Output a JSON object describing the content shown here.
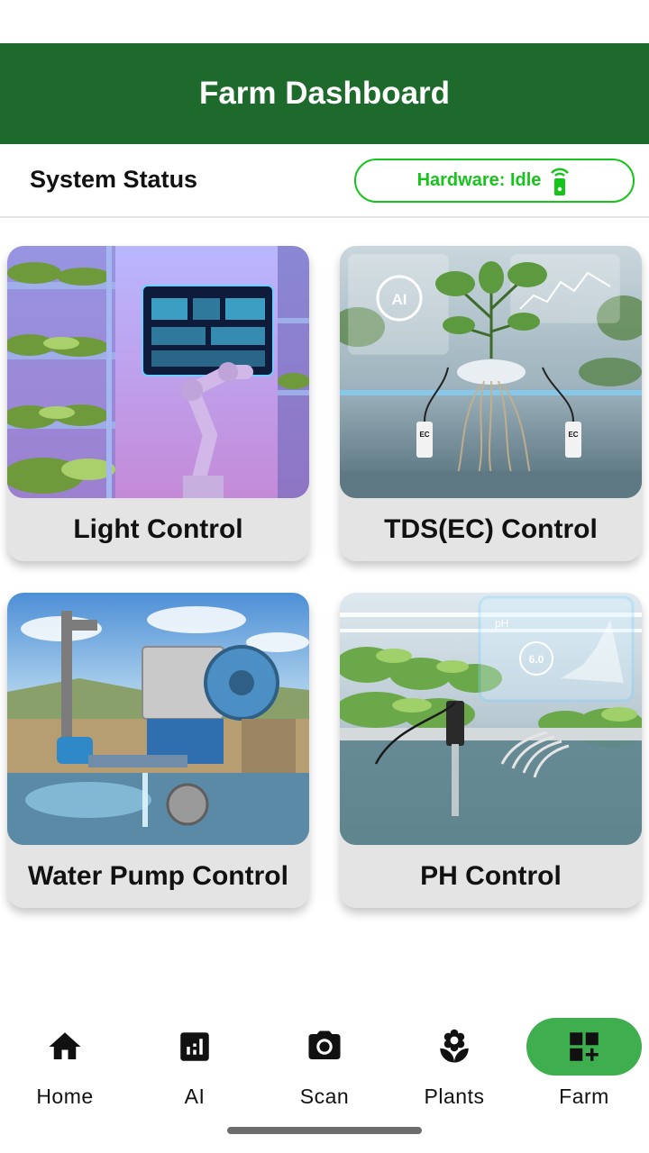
{
  "app_bar": {
    "title": "Farm Dashboard"
  },
  "status": {
    "title": "System Status",
    "hardware_label": "Hardware: Idle",
    "hardware_color": "#16c41c",
    "hardware_icon": "signal-device-icon"
  },
  "cards": [
    {
      "label": "Light Control",
      "image": "vertical-farm-robot-image"
    },
    {
      "label": "TDS(EC) Control",
      "image": "hydroponic-ec-sensor-image"
    },
    {
      "label": "Water Pump Control",
      "image": "water-pump-image"
    },
    {
      "label": "PH Control",
      "image": "ph-sensor-image"
    }
  ],
  "image_text": {
    "ai": "AI",
    "ec": "EC",
    "ph": "pH",
    "ph_value": "6.0"
  },
  "nav": {
    "items": [
      {
        "label": "Home",
        "icon": "home-icon"
      },
      {
        "label": "AI",
        "icon": "analytics-icon"
      },
      {
        "label": "Scan",
        "icon": "camera-icon"
      },
      {
        "label": "Plants",
        "icon": "flower-icon"
      },
      {
        "label": "Farm",
        "icon": "dashboard-add-icon",
        "active": true
      }
    ],
    "active_color": "#3fae4f"
  },
  "colors": {
    "primary": "#1e6a2c",
    "accent": "#16c41c"
  }
}
